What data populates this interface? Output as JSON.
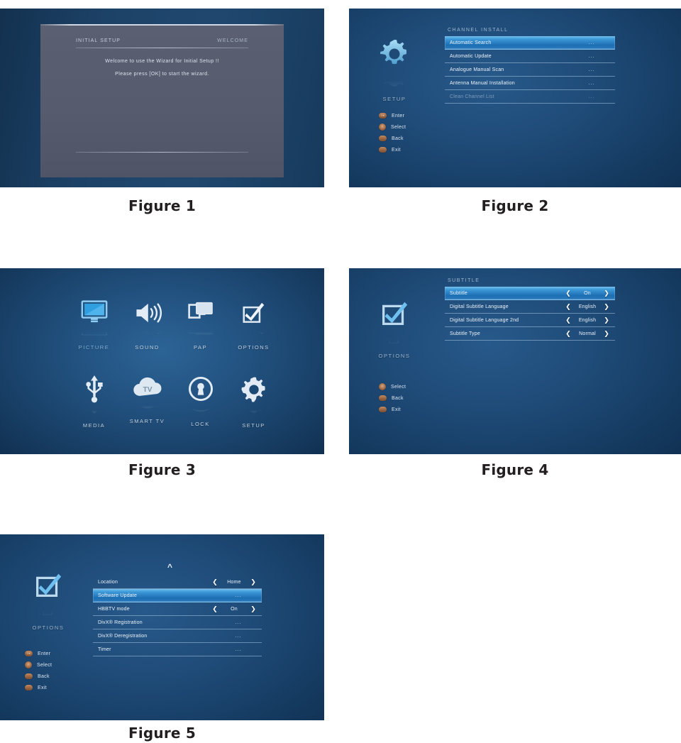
{
  "figures": [
    {
      "caption": "Figure 1"
    },
    {
      "caption": "Figure 2"
    },
    {
      "caption": "Figure 3"
    },
    {
      "caption": "Figure 4"
    },
    {
      "caption": "Figure 5"
    }
  ],
  "figure1": {
    "header_left": "INITIAL SETUP",
    "header_right": "WELCOME",
    "line1": "Welcome to use the Wizard for Initial Setup !!",
    "line2": "Please press [OK] to start the wizard."
  },
  "figure2": {
    "icon_name": "gear-icon",
    "icon_label": "SETUP",
    "menu_title": "CHANNEL INSTALL",
    "rows": [
      {
        "label": "Automatic Search",
        "value": "...",
        "selected": true,
        "disabled": false,
        "type": "dots"
      },
      {
        "label": "Automatic Update",
        "value": "...",
        "selected": false,
        "disabled": false,
        "type": "dots"
      },
      {
        "label": "Analogue Manual Scan",
        "value": "...",
        "selected": false,
        "disabled": false,
        "type": "dots"
      },
      {
        "label": "Antenna Manual Installation",
        "value": "...",
        "selected": false,
        "disabled": false,
        "type": "dots"
      },
      {
        "label": "Clean Channel List",
        "value": "...",
        "selected": false,
        "disabled": true,
        "type": "dots"
      }
    ],
    "keys": [
      {
        "glyph": "OK",
        "icon": "ok-button-icon",
        "label": "Enter"
      },
      {
        "glyph": "",
        "icon": "dpad-button-icon",
        "label": "Select"
      },
      {
        "glyph": "",
        "icon": "back-button-icon",
        "label": "Back"
      },
      {
        "glyph": "",
        "icon": "exit-button-icon",
        "label": "Exit"
      }
    ]
  },
  "figure3": {
    "items": [
      {
        "label": "PICTURE",
        "icon": "tv-monitor-icon",
        "active": true
      },
      {
        "label": "SOUND",
        "icon": "speaker-icon",
        "active": false
      },
      {
        "label": "PAP",
        "icon": "pap-windows-icon",
        "active": false
      },
      {
        "label": "OPTIONS",
        "icon": "checkbox-icon",
        "active": false
      },
      {
        "label": "MEDIA",
        "icon": "usb-icon",
        "active": false
      },
      {
        "label": "SMART TV",
        "icon": "cloud-tv-icon",
        "active": false
      },
      {
        "label": "LOCK",
        "icon": "padlock-icon",
        "active": false
      },
      {
        "label": "SETUP",
        "icon": "gear-icon",
        "active": false
      }
    ],
    "smart_tv_icon_text": "TV"
  },
  "figure4": {
    "icon_name": "checkbox-icon",
    "icon_label": "OPTIONS",
    "menu_title": "SUBTITLE",
    "rows": [
      {
        "label": "Subtitle",
        "value": "On",
        "selected": true,
        "disabled": false,
        "type": "spinner"
      },
      {
        "label": "Digital Subtitle Language",
        "value": "English",
        "selected": false,
        "disabled": false,
        "type": "spinner"
      },
      {
        "label": "Digital Subtitle Language 2nd",
        "value": "English",
        "selected": false,
        "disabled": false,
        "type": "spinner"
      },
      {
        "label": "Subtitle Type",
        "value": "Normal",
        "selected": false,
        "disabled": false,
        "type": "spinner"
      }
    ],
    "keys": [
      {
        "glyph": "",
        "icon": "dpad-button-icon",
        "label": "Select"
      },
      {
        "glyph": "",
        "icon": "back-button-icon",
        "label": "Back"
      },
      {
        "glyph": "",
        "icon": "exit-button-icon",
        "label": "Exit"
      }
    ]
  },
  "figure5": {
    "icon_name": "checkbox-icon",
    "icon_label": "OPTIONS",
    "scroll_up_icon": "chevron-up-icon",
    "rows": [
      {
        "label": "Location",
        "value": "Home",
        "selected": false,
        "disabled": false,
        "type": "spinner"
      },
      {
        "label": "Software Update",
        "value": "...",
        "selected": true,
        "disabled": false,
        "type": "dots"
      },
      {
        "label": "HBBTV mode",
        "value": "On",
        "selected": false,
        "disabled": false,
        "type": "spinner"
      },
      {
        "label": "DivX® Registration",
        "value": "...",
        "selected": false,
        "disabled": false,
        "type": "dots"
      },
      {
        "label": "DivX® Deregistration",
        "value": "...",
        "selected": false,
        "disabled": false,
        "type": "dots"
      },
      {
        "label": "Timer",
        "value": "...",
        "selected": false,
        "disabled": false,
        "type": "dots"
      }
    ],
    "keys": [
      {
        "glyph": "OK",
        "icon": "ok-button-icon",
        "label": "Enter"
      },
      {
        "glyph": "",
        "icon": "dpad-button-icon",
        "label": "Select"
      },
      {
        "glyph": "",
        "icon": "back-button-icon",
        "label": "Back"
      },
      {
        "glyph": "",
        "icon": "exit-button-icon",
        "label": "Exit"
      }
    ]
  },
  "colors": {
    "panel_blue": "#1d4267",
    "highlight_from": "#6fc0ef",
    "highlight_to": "#1d6fb4",
    "wizard_panel": "#565c6e",
    "caption_text": "#231f20",
    "menu_text": "#eef4fa",
    "menu_title": "#9fb5cb",
    "disabled_text": "#7e9cb8",
    "key_button": "#9a6440"
  }
}
